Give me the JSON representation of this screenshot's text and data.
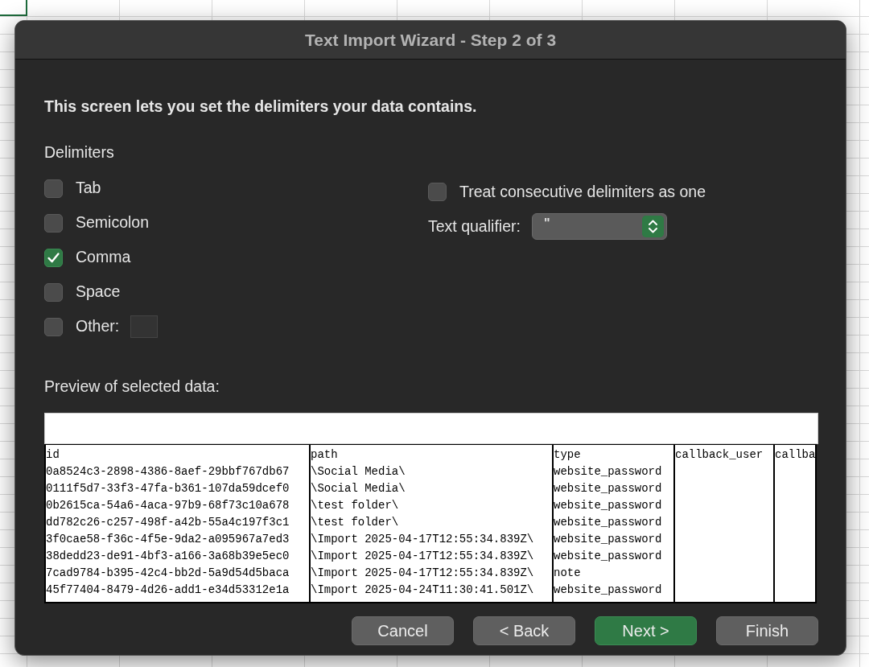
{
  "window": {
    "title": "Text Import Wizard - Step 2 of 3"
  },
  "instruction": "This screen lets you set the delimiters your data contains.",
  "delimiters": {
    "label": "Delimiters",
    "options": [
      {
        "kind": "checkbox",
        "label": "Tab",
        "checked": false
      },
      {
        "kind": "checkbox",
        "label": "Semicolon",
        "checked": false
      },
      {
        "kind": "checkbox",
        "label": "Comma",
        "checked": true
      },
      {
        "kind": "checkbox",
        "label": "Space",
        "checked": false
      },
      {
        "kind": "checkbox_with_field",
        "label": "Other:",
        "checked": false
      }
    ]
  },
  "consecutive": {
    "label": "Treat consecutive delimiters as one",
    "checked": false
  },
  "text_qualifier": {
    "label": "Text qualifier:",
    "value": "\""
  },
  "preview": {
    "label": "Preview of selected data:",
    "columns": [
      "id",
      "path",
      "type",
      "callback_user",
      "callba"
    ],
    "rows": [
      [
        "0a8524c3-2898-4386-8aef-29bbf767db67",
        "\\Social Media\\",
        "website_password"
      ],
      [
        "0111f5d7-33f3-47fa-b361-107da59dcef0",
        "\\Social Media\\",
        "website_password"
      ],
      [
        "0b2615ca-54a6-4aca-97b9-68f73c10a678",
        "\\test folder\\",
        "website_password"
      ],
      [
        "dd782c26-c257-498f-a42b-55a4c197f3c1",
        "\\test folder\\",
        "website_password"
      ],
      [
        "3f0cae58-f36c-4f5e-9da2-a095967a7ed3",
        "\\Import 2025-04-17T12:55:34.839Z\\",
        "website_password"
      ],
      [
        "38dedd23-de91-4bf3-a166-3a68b39e5ec0",
        "\\Import 2025-04-17T12:55:34.839Z\\",
        "website_password"
      ],
      [
        "7cad9784-b395-42c4-bb2d-5a9d54d5baca",
        "\\Import 2025-04-17T12:55:34.839Z\\",
        "note"
      ],
      [
        "45f77404-8479-4d26-add1-e34d53312e1a",
        "\\Import 2025-04-24T11:30:41.501Z\\",
        "website_password"
      ]
    ]
  },
  "buttons": [
    {
      "label": "Cancel",
      "primary": false
    },
    {
      "label": "< Back",
      "primary": false
    },
    {
      "label": "Next >",
      "primary": true
    },
    {
      "label": "Finish",
      "primary": false
    }
  ]
}
